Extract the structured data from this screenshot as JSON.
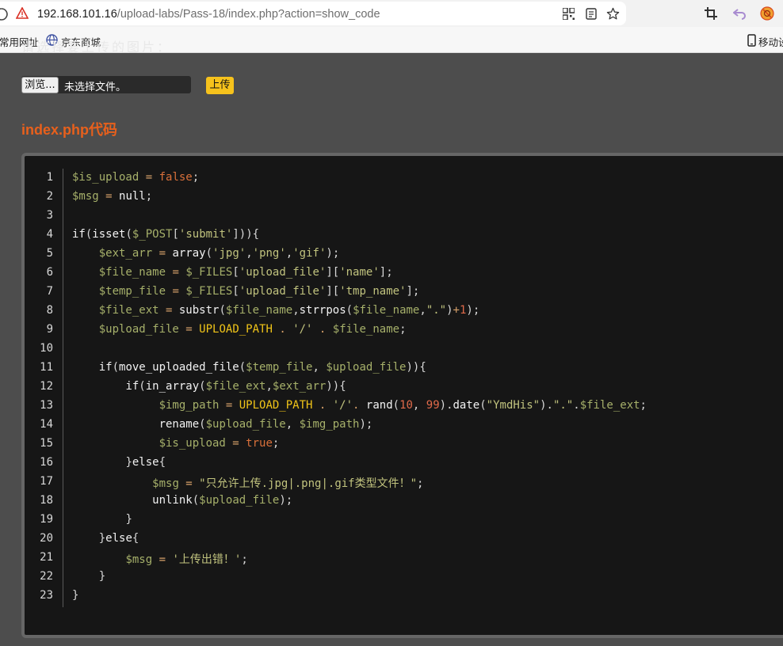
{
  "browser": {
    "url_host": "192.168.101.16",
    "url_path": "/upload-labs/Pass-18/index.php?action=show_code",
    "bookmarks": [
      {
        "label": "常用网址",
        "icon": "folder-icon"
      },
      {
        "label": "京东商城",
        "icon": "globe-icon"
      }
    ],
    "mobile_label": "移动设",
    "icons": [
      "not-secure-icon",
      "qr-code-icon",
      "reader-mode-icon",
      "star-icon",
      "crop-icon",
      "back-arrow-icon",
      "extension-icon",
      "phone-icon"
    ]
  },
  "page": {
    "cut_off_text": "请选择要上传的图片：",
    "browse_label": "浏览...",
    "no_file_label": "未选择文件。",
    "upload_label": "上传",
    "code_title": "index.php代码"
  },
  "code": {
    "line_numbers": [
      "1",
      "2",
      "3",
      "4",
      "5",
      "6",
      "7",
      "8",
      "9",
      "10",
      "11",
      "12",
      "13",
      "14",
      "15",
      "16",
      "17",
      "18",
      "19",
      "20",
      "21",
      "22",
      "23"
    ],
    "colors": {
      "variable": "#a6b06a",
      "string": "#c1c37e",
      "literal": "#d9703a",
      "constant": "#f0c418",
      "background": "#161616"
    }
  }
}
